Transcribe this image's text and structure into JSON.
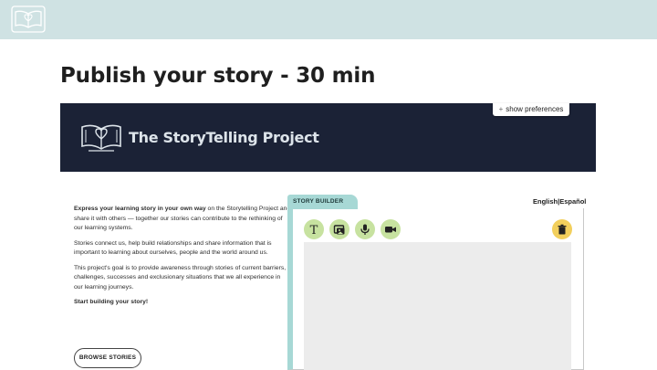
{
  "slide": {
    "title": "Publish your story - 30 min"
  },
  "banner": {
    "title": "The StoryTelling Project",
    "preferences_label": "show preferences",
    "preferences_icon": "plus-icon"
  },
  "intro": {
    "p1_bold": "Express your learning story in your own way",
    "p1_rest": " on the Storytelling Project and share it with others — together our stories can contribute to the rethinking of our learning systems.",
    "p2": "Stories connect us, help build relationships and share information that is important to learning about ourselves, people and the world around us.",
    "p3": "This project's goal is to provide awareness through stories of current barriers, challenges, successes and exclusionary situations that we all experience in our learning journeys.",
    "p4": "Start building your story!"
  },
  "browse_label": "BROWSE STORIES",
  "lang": {
    "english": "English",
    "sep": "|",
    "spanish": "Español"
  },
  "builder": {
    "tab_label": "STORY BUILDER",
    "tools": [
      {
        "icon": "text-icon",
        "glyph": "T"
      },
      {
        "icon": "image-icon"
      },
      {
        "icon": "microphone-icon"
      },
      {
        "icon": "video-camera-icon"
      }
    ],
    "trash_icon": "trash-icon"
  },
  "colors": {
    "accent_teal": "#a7d8d5",
    "tool_green": "#c7e2a0",
    "trash_yellow": "#f2cf5c",
    "banner_navy": "#1b2236",
    "top_bar": "#cfe2e3"
  }
}
